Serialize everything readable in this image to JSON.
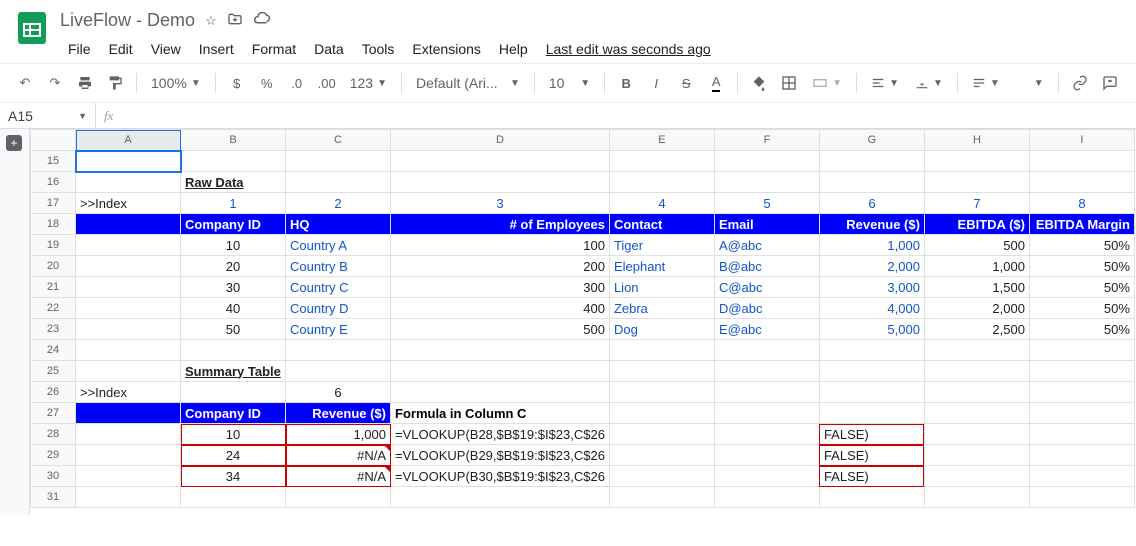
{
  "doc": {
    "title": "LiveFlow - Demo",
    "last_edit": "Last edit was seconds ago"
  },
  "menu": {
    "file": "File",
    "edit": "Edit",
    "view": "View",
    "insert": "Insert",
    "format": "Format",
    "data": "Data",
    "tools": "Tools",
    "extensions": "Extensions",
    "help": "Help"
  },
  "toolbar": {
    "zoom": "100%",
    "font": "Default (Ari...",
    "size": "10"
  },
  "namebox": "A15",
  "cols": [
    "A",
    "B",
    "C",
    "D",
    "E",
    "F",
    "G",
    "H",
    "I"
  ],
  "rows": [
    "15",
    "16",
    "17",
    "18",
    "19",
    "20",
    "21",
    "22",
    "23",
    "24",
    "25",
    "26",
    "27",
    "28",
    "29",
    "30",
    "31"
  ],
  "labels": {
    "raw_data": "Raw Data",
    "index": ">>Index",
    "summary": "Summary Table",
    "headers": {
      "company": "Company ID",
      "hq": "HQ",
      "emp": "# of Employees",
      "contact": "Contact",
      "email": "Email",
      "revenue": "Revenue ($)",
      "ebitda": "EBITDA ($)",
      "margin": "EBITDA Margin"
    },
    "idx_nums": {
      "1": "1",
      "2": "2",
      "3": "3",
      "4": "4",
      "5": "5",
      "6": "6",
      "7": "7",
      "8": "8"
    },
    "sum_headers": {
      "company": "Company ID",
      "revenue": "Revenue ($)",
      "formula": "Formula in Column C"
    }
  },
  "raw_rows": [
    {
      "id": "10",
      "hq": "Country A",
      "emp": "100",
      "contact": "Tiger",
      "email": "A@abc",
      "rev": "1,000",
      "ebitda": "500",
      "margin": "50%"
    },
    {
      "id": "20",
      "hq": "Country B",
      "emp": "200",
      "contact": "Elephant",
      "email": "B@abc",
      "rev": "2,000",
      "ebitda": "1,000",
      "margin": "50%"
    },
    {
      "id": "30",
      "hq": "Country C",
      "emp": "300",
      "contact": "Lion",
      "email": "C@abc",
      "rev": "3,000",
      "ebitda": "1,500",
      "margin": "50%"
    },
    {
      "id": "40",
      "hq": "Country D",
      "emp": "400",
      "contact": "Zebra",
      "email": "D@abc",
      "rev": "4,000",
      "ebitda": "2,000",
      "margin": "50%"
    },
    {
      "id": "50",
      "hq": "Country E",
      "emp": "500",
      "contact": "Dog",
      "email": "E@abc",
      "rev": "5,000",
      "ebitda": "2,500",
      "margin": "50%"
    }
  ],
  "summary_idx": "6",
  "summary_rows": [
    {
      "id": "10",
      "rev": "1,000",
      "formula": "=VLOOKUP(B28,$B$19:$I$23,C$26",
      "false": "FALSE)"
    },
    {
      "id": "24",
      "rev": "#N/A",
      "formula": "=VLOOKUP(B29,$B$19:$I$23,C$26",
      "false": "FALSE)"
    },
    {
      "id": "34",
      "rev": "#N/A",
      "formula": "=VLOOKUP(B30,$B$19:$I$23,C$26",
      "false": "FALSE)"
    }
  ]
}
